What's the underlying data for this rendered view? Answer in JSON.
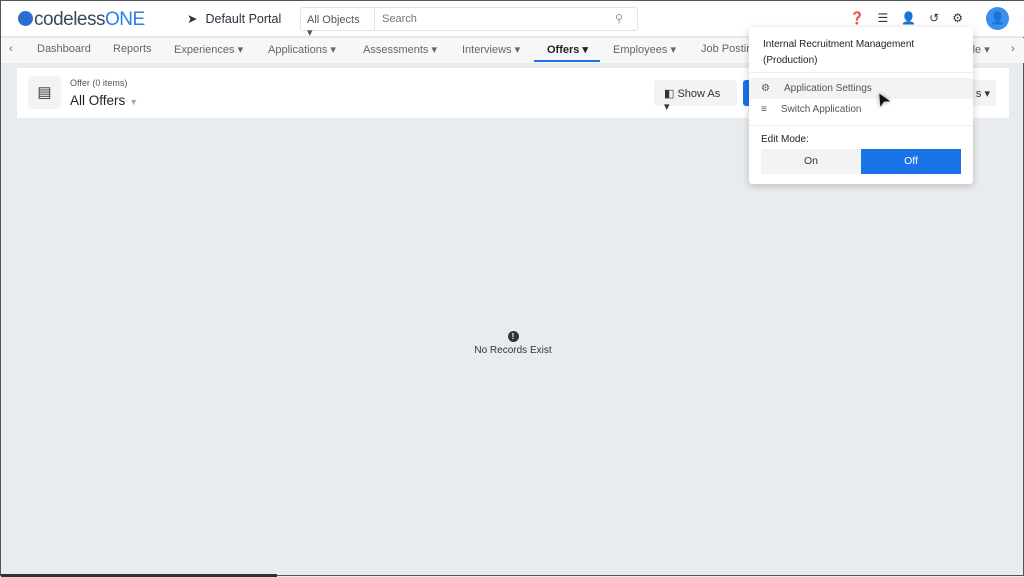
{
  "header": {
    "logo": "codelessONE",
    "portal": "Default Portal",
    "search_scope": "All Objects",
    "search_placeholder": "Search"
  },
  "nav": {
    "items": [
      {
        "label": "Dashboard"
      },
      {
        "label": "Reports"
      },
      {
        "label": "Experiences ▾"
      },
      {
        "label": "Applications ▾"
      },
      {
        "label": "Assessments ▾"
      },
      {
        "label": "Interviews ▾"
      },
      {
        "label": "Offers ▾"
      },
      {
        "label": "Employees ▾"
      },
      {
        "label": "Job Postin"
      },
      {
        "label": "ofile ▾"
      }
    ],
    "active": "Offers"
  },
  "panel": {
    "subtitle": "Offer (0 items)",
    "title": "All Offers",
    "show_as": "Show As ▾",
    "right_button": "s ▾"
  },
  "empty": {
    "message": "No Records Exist"
  },
  "dropdown": {
    "app_name": "Internal Recruitment Management (Production)",
    "items": [
      {
        "label": "Application Settings",
        "icon": "gears-icon"
      },
      {
        "label": "Switch Application",
        "icon": "list-icon"
      }
    ],
    "edit_mode_label": "Edit Mode:",
    "on": "On",
    "off": "Off",
    "selected": "Off"
  },
  "colors": {
    "accent": "#1a73e8"
  }
}
